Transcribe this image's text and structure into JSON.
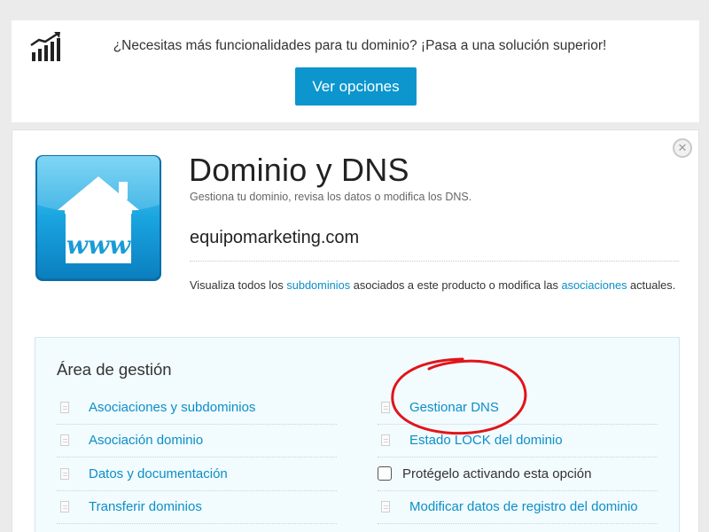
{
  "promo": {
    "icon": "chart-growth-icon",
    "text": "¿Necesitas más funcionalidades para tu dominio? ¡Pasa a una solución superior!",
    "button_label": "Ver opciones"
  },
  "panel": {
    "close_icon": "close-icon",
    "product_icon": "house-www-icon",
    "title": "Dominio y DNS",
    "subtitle": "Gestiona tu dominio, revisa los datos o modifica los DNS.",
    "domain": "equipomarketing.com",
    "info": {
      "before": "Visualiza todos los ",
      "link1": "subdominios",
      "middle": " asociados a este producto o modifica las ",
      "link2": "asociaciones",
      "after": " actuales."
    }
  },
  "management": {
    "title": "Área de gestión",
    "left_items": [
      {
        "label": "Asociaciones y subdominios"
      },
      {
        "label": "Asociación dominio"
      },
      {
        "label": "Datos y documentación"
      },
      {
        "label": "Transferir dominios"
      }
    ],
    "right_items": [
      {
        "label": "Gestionar DNS"
      },
      {
        "label": "Estado LOCK del dominio"
      },
      {
        "label": "Protégelo activando esta opción"
      },
      {
        "label": "Modificar datos de registro del dominio"
      }
    ]
  },
  "colors": {
    "accent": "#0c96cd",
    "link": "#0b8fc7",
    "highlight_circle": "#e0151b"
  }
}
